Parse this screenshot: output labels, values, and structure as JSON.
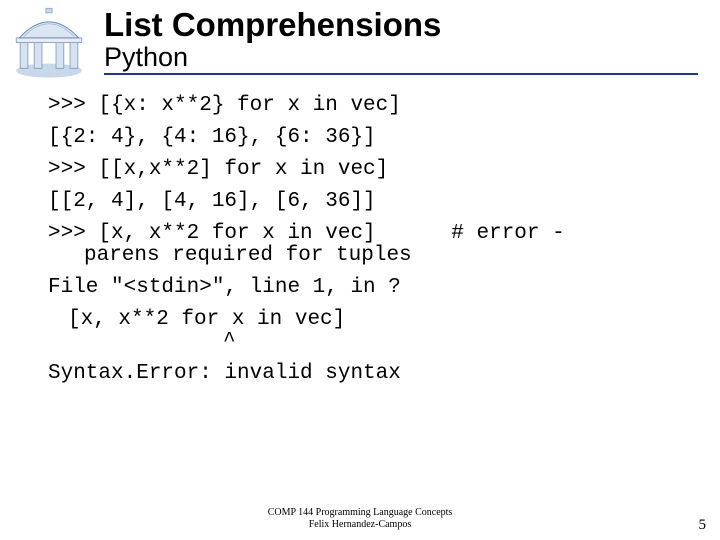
{
  "header": {
    "title": "List Comprehensions",
    "subtitle": "Python"
  },
  "code": {
    "l1": ">>> [{x: x**2} for x in vec]",
    "l2": "[{2: 4}, {4: 16}, {6: 36}]",
    "l3": ">>> [[x,x**2] for x in vec]",
    "l4": "[[2, 4], [4, 16], [6, 36]]",
    "l5a": ">>> [x, x**2 for x in vec]",
    "l5b": "# error -",
    "l5c": "parens required for tuples",
    "l6": "File \"<stdin>\", line 1, in ?",
    "l7": "[x, x**2 for x in vec]",
    "l8": "^",
    "l9": "Syntax.Error: invalid syntax"
  },
  "footer": {
    "line1": "COMP 144 Programming Language Concepts",
    "line2": "Felix Hernandez-Campos"
  },
  "page": "5"
}
